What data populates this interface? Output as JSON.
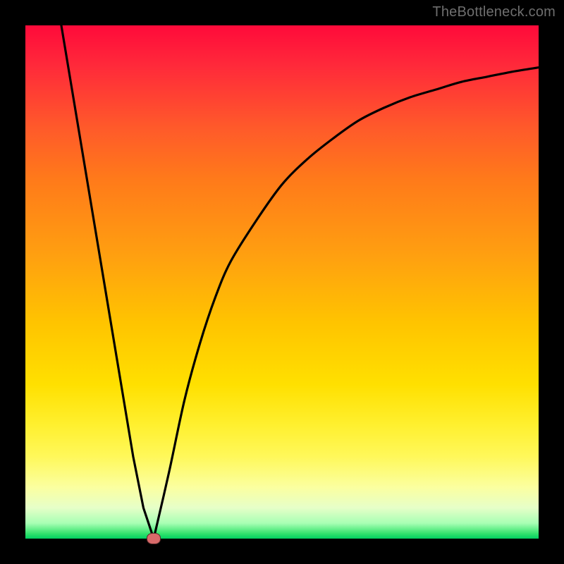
{
  "watermark": "TheBottleneck.com",
  "colors": {
    "frame": "#000000",
    "curve_stroke": "#000000",
    "marker_fill": "#d86a6a",
    "marker_border": "#5a2a2a"
  },
  "chart_data": {
    "type": "line",
    "title": "",
    "xlabel": "",
    "ylabel": "",
    "xlim": [
      0,
      100
    ],
    "ylim": [
      0,
      100
    ],
    "grid": false,
    "legend": null,
    "series": [
      {
        "name": "curve",
        "x": [
          7,
          9,
          11,
          13,
          15,
          17,
          19,
          21,
          23,
          25,
          28,
          31,
          34,
          37,
          40,
          45,
          50,
          55,
          60,
          65,
          70,
          75,
          80,
          85,
          90,
          95,
          100
        ],
        "y": [
          100,
          88,
          76,
          64,
          52,
          40,
          28,
          16,
          6,
          0,
          13,
          27,
          38,
          47,
          54,
          62,
          69,
          74,
          78,
          81.5,
          84,
          86,
          87.5,
          89,
          90,
          91,
          91.8
        ]
      }
    ],
    "marker": {
      "x": 25,
      "y": 0
    },
    "gradient_stops": [
      {
        "pos": 0,
        "color": "#ff0a3a"
      },
      {
        "pos": 8,
        "color": "#ff2a3a"
      },
      {
        "pos": 20,
        "color": "#ff5a2a"
      },
      {
        "pos": 30,
        "color": "#ff7a1a"
      },
      {
        "pos": 45,
        "color": "#ffa010"
      },
      {
        "pos": 58,
        "color": "#ffc400"
      },
      {
        "pos": 70,
        "color": "#ffe000"
      },
      {
        "pos": 78,
        "color": "#fff030"
      },
      {
        "pos": 84,
        "color": "#fff85a"
      },
      {
        "pos": 90,
        "color": "#fbffa0"
      },
      {
        "pos": 94,
        "color": "#e6ffc8"
      },
      {
        "pos": 97,
        "color": "#a8ffb4"
      },
      {
        "pos": 99,
        "color": "#34e36e"
      },
      {
        "pos": 100,
        "color": "#00d060"
      }
    ]
  }
}
